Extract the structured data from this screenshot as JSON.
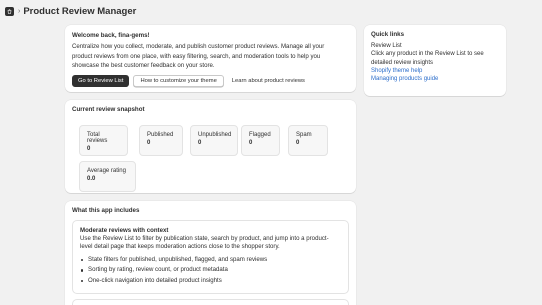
{
  "header": {
    "breadcrumb_chevron": "›",
    "title": "Product Review Manager",
    "app_icon": "shopify-bag-icon"
  },
  "welcome": {
    "heading": "Welcome back, fina-gems!",
    "description_lines": [
      "Centralize how you collect, moderate, and publish customer product reviews. Manage all your",
      "product reviews from one place, with easy filtering, search, and moderation tools to help you",
      "showcase the best customer feedback on your store."
    ],
    "buttons": {
      "primary": "Go to Review List",
      "secondary": "How to customize your theme",
      "plain": "Learn about product reviews"
    }
  },
  "snapshot": {
    "heading": "Current review snapshot",
    "stats": [
      {
        "label": "Total reviews",
        "value": "0"
      },
      {
        "label": "Published",
        "value": "0"
      },
      {
        "label": "Unpublished",
        "value": "0"
      },
      {
        "label": "Flagged",
        "value": "0"
      },
      {
        "label": "Spam",
        "value": "0"
      },
      {
        "label": "Average rating",
        "value": "0.0"
      }
    ]
  },
  "includes": {
    "heading": "What this app includes",
    "feature": {
      "title": "Moderate reviews with context",
      "description_lines": [
        "Use the Review List to filter by publication state, search by product, and jump into a product-",
        "level detail page that keeps moderation actions close to the shopper story."
      ],
      "bullets": [
        "State filters for published, unpublished, flagged, and spam reviews",
        "Sorting by rating, review count, or product metadata",
        "One-click navigation into detailed product insights"
      ]
    }
  },
  "quick_links": {
    "heading": "Quick links",
    "items": [
      {
        "lines": [
          "Review List"
        ],
        "is_link": false
      },
      {
        "lines": [
          "Click any product in the Review List to see",
          "detailed review insights"
        ],
        "is_link": false
      },
      {
        "lines": [
          "Shopify theme help"
        ],
        "is_link": true
      },
      {
        "lines": [
          "Managing products guide"
        ],
        "is_link": true
      }
    ]
  },
  "colors": {
    "background": "#f1f1f1",
    "card": "#ffffff",
    "primary_button": "#303030",
    "link": "#2c6ecb"
  }
}
